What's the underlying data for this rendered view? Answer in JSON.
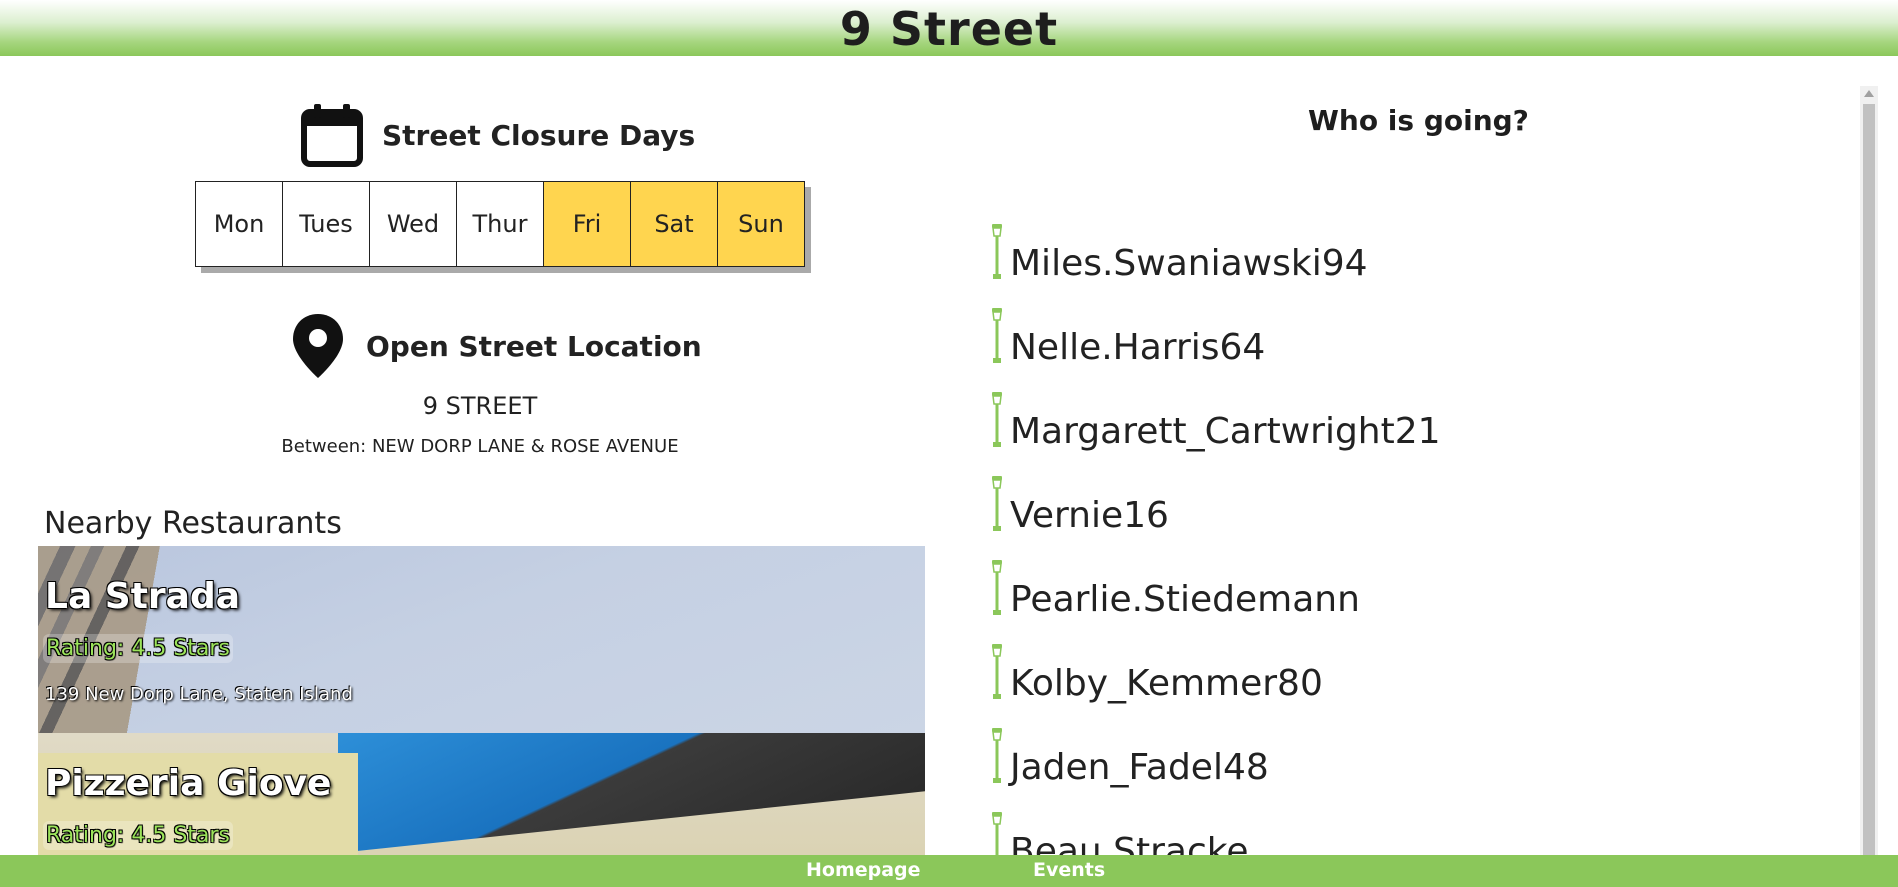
{
  "header": {
    "title": "9 Street"
  },
  "closure": {
    "icon": "calendar-icon",
    "title": "Street Closure Days",
    "days": [
      {
        "label": "Mon",
        "active": false
      },
      {
        "label": "Tues",
        "active": false
      },
      {
        "label": "Wed",
        "active": false
      },
      {
        "label": "Thur",
        "active": false
      },
      {
        "label": "Fri",
        "active": true
      },
      {
        "label": "Sat",
        "active": true
      },
      {
        "label": "Sun",
        "active": true
      }
    ],
    "active_color": "#ffd54f"
  },
  "location": {
    "icon": "map-pin-icon",
    "title": "Open Street Location",
    "street": "9 STREET",
    "between": "Between: NEW DORP LANE & ROSE AVENUE"
  },
  "nearby": {
    "title": "Nearby Restaurants",
    "restaurants": [
      {
        "name": "La Strada",
        "rating": "Rating: 4.5 Stars",
        "address": "139 New Dorp Lane, Staten Island"
      },
      {
        "name": "Pizzeria Giove",
        "rating": "Rating: 4.5 Stars",
        "address": ""
      }
    ]
  },
  "attendance": {
    "title": "Who is going?",
    "icon": "street-lamp-icon",
    "people": [
      "Miles.Swaniawski94",
      "Nelle.Harris64",
      "Margarett_Cartwright21",
      "Vernie16",
      "Pearlie.Stiedemann",
      "Kolby_Kemmer80",
      "Jaden_Fadel48",
      "Beau.Stracke"
    ]
  },
  "footer": {
    "links": [
      "Homepage",
      "Events"
    ]
  },
  "colors": {
    "brand_green": "#8bc75a",
    "highlight_yellow": "#ffd54f"
  }
}
